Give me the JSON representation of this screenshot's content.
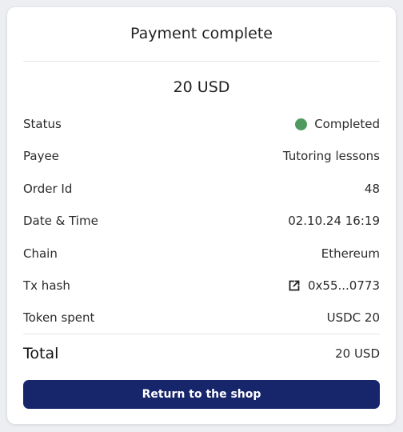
{
  "header": {
    "title": "Payment complete"
  },
  "amount": "20 USD",
  "details": {
    "status": {
      "label": "Status",
      "value": "Completed",
      "color": "#4f9a5e"
    },
    "payee": {
      "label": "Payee",
      "value": "Tutoring lessons"
    },
    "order_id": {
      "label": "Order Id",
      "value": "48"
    },
    "date_time": {
      "label": "Date & Time",
      "value": "02.10.24 16:19"
    },
    "chain": {
      "label": "Chain",
      "value": "Ethereum"
    },
    "tx_hash": {
      "label": "Tx hash",
      "value": "0x55...0773",
      "icon": "external-link-icon"
    },
    "token_spent": {
      "label": "Token spent",
      "value": "USDC 20"
    }
  },
  "total": {
    "label": "Total",
    "value": "20 USD"
  },
  "actions": {
    "return_label": "Return to the shop",
    "button_color": "#17266b"
  }
}
